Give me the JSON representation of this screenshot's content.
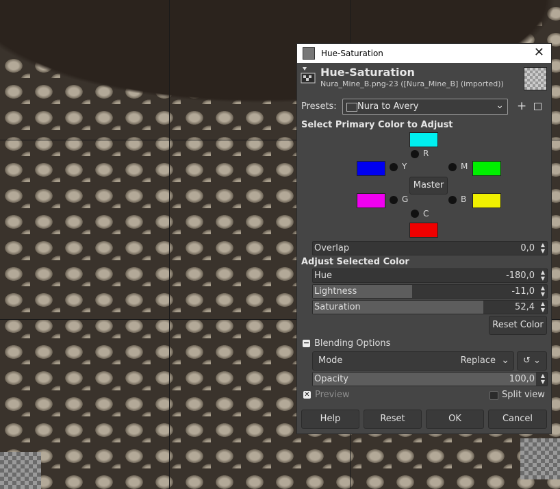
{
  "window": {
    "title": "Hue-Saturation",
    "close_label": "✕"
  },
  "header": {
    "title": "Hue-Saturation",
    "subtitle": "Nura_Mine_B.png-23 ([Nura_Mine_B] (imported))"
  },
  "presets": {
    "label": "Presets:",
    "value": "Nura to Avery",
    "add_label": "+"
  },
  "primary": {
    "heading": "Select Primary Color to Adjust",
    "labels": {
      "R": "R",
      "Y": "Y",
      "M": "M",
      "G": "G",
      "B": "B",
      "C": "C"
    },
    "master_label": "Master",
    "colors": {
      "R": "#00f0f0",
      "Y": "#0000f0",
      "M": "#00f000",
      "G": "#f000f0",
      "B": "#f0f000",
      "C": "#f00000"
    }
  },
  "overlap": {
    "label": "Overlap",
    "value": "0,0"
  },
  "adjust": {
    "heading": "Adjust Selected Color",
    "hue": {
      "label": "Hue",
      "value": "-180,0"
    },
    "lightness": {
      "label": "Lightness",
      "value": "-11,0"
    },
    "saturation": {
      "label": "Saturation",
      "value": "52,4"
    },
    "reset_color": "Reset Color"
  },
  "blending": {
    "heading": "Blending Options",
    "mode_label": "Mode",
    "mode_value": "Replace",
    "opacity": {
      "label": "Opacity",
      "value": "100,0"
    }
  },
  "preview": {
    "label": "Preview",
    "checked": true
  },
  "split_view": {
    "label": "Split view",
    "checked": false
  },
  "buttons": {
    "help": "Help",
    "reset": "Reset",
    "ok": "OK",
    "cancel": "Cancel"
  }
}
